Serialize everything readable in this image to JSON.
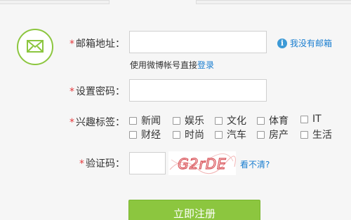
{
  "form": {
    "email": {
      "label": "邮箱地址：",
      "value": ""
    },
    "hint_prefix": "使用微博帐号直接",
    "hint_link": "登录",
    "no_email_link": "我没有邮箱",
    "password": {
      "label": "设置密码：",
      "value": ""
    },
    "interests": {
      "label": "兴趣标签：",
      "options": [
        "新闻",
        "娱乐",
        "文化",
        "体育",
        "IT",
        "财经",
        "时尚",
        "汽车",
        "房产",
        "生活"
      ]
    },
    "captcha": {
      "label": "验证码：",
      "value": "",
      "image_text": "G2rDE",
      "refresh_link": "看不清?"
    },
    "submit_label": "立即注册"
  },
  "colors": {
    "accent": "#8cc63f",
    "link": "#1a7ed0",
    "required": "#e4393c"
  },
  "icons": {
    "badge": "envelope-icon",
    "info": "info-icon"
  }
}
